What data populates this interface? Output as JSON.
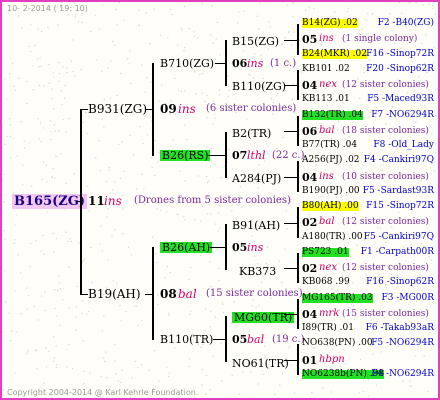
{
  "header_date": "10-  2-2014 ( 19: 10)",
  "footer": "Copyright 2004-2014 @ Karl Kehrle Foundation.",
  "root": {
    "label": "B165(ZG)",
    "gen": "11",
    "ins": "ins",
    "note": "(Drones from 5 sister colonies)"
  },
  "dam1": {
    "label": "B931(ZG)",
    "gen": "09",
    "ins": "ins",
    "note": "(6 sister colonies)"
  },
  "dam2": {
    "label": "B19(AH)",
    "gen": "08",
    "ins": "bal",
    "note": "(15 sister colonies)"
  },
  "g1": {
    "label": "B710(ZG)",
    "gen": "06",
    "ins": "ins",
    "note": "(1 c.)"
  },
  "g2": {
    "label": "B26(RS)",
    "gen": "07",
    "ins": "lthl",
    "note": "(22 c.)"
  },
  "g3": {
    "label": "B26(AH)",
    "gen": "05",
    "ins": "ins"
  },
  "g4": {
    "label": "B110(TR)",
    "gen": "05",
    "ins": "bal",
    "note": "(19 c.)"
  },
  "l3": {
    "a": "B15(ZG)",
    "b": "B110(ZG)",
    "c": "B2(TR)",
    "d": "A284(PJ)",
    "e": "B91(AH)",
    "f": "KB373",
    "g": "MG60(TR)",
    "h": "NO61(TR)"
  },
  "r": [
    {
      "n": "B14(ZG) .02",
      "s": "F2 -B40(ZG)"
    },
    {
      "g": "05",
      "i": "ins",
      "t": "(1 single colony)"
    },
    {
      "n": "B24(MKR) .02",
      "s": "F16 -Sinop72R"
    },
    {
      "n": "KB101 .02",
      "s": "F20 -Sinop62R"
    },
    {
      "g": "04",
      "i": "nex",
      "t": "(12 sister colonies)"
    },
    {
      "n": "KB113 .01",
      "s": "F5 -Maced93R"
    },
    {
      "n": "B132(TR) .04",
      "s": "F7 -NO6294R"
    },
    {
      "g": "06",
      "i": "bal",
      "t": "(18 sister colonies)"
    },
    {
      "n": "B77(TR) .04",
      "s": "F8 -Old_Lady"
    },
    {
      "n": "A256(PJ) .02",
      "s": "F4 -Cankiri97Q"
    },
    {
      "g": "04",
      "i": "ins",
      "t": "(10 sister colonies)"
    },
    {
      "n": "B190(PJ) .00",
      "s": "F5 -Sardast93R"
    },
    {
      "n": "B80(AH) .00",
      "s": "F15 -Sinop72R"
    },
    {
      "g": "02",
      "i": "bal",
      "t": "(12 sister colonies)"
    },
    {
      "n": "A180(TR) .00",
      "s": "F5 -Cankiri97Q"
    },
    {
      "n": "PS723 .01",
      "s": "F1 -Carpath00R"
    },
    {
      "g": "02",
      "i": "nex",
      "t": "(12 sister colonies)"
    },
    {
      "n": "KB068 .99",
      "s": "F16 -Sinop62R"
    },
    {
      "n": "MG165(TR) .03",
      "s": "F3 -MG00R"
    },
    {
      "g": "04",
      "i": "mrk",
      "t": "(15 sister colonies)"
    },
    {
      "n": "I89(TR) .01",
      "s": "F6 -Takab93aR"
    },
    {
      "n": "NO638(PN) .00",
      "s": "F5 -NO6294R"
    },
    {
      "g": "01",
      "i": "hbpn",
      "t": ""
    },
    {
      "n": "NO6238b(PN) .98",
      "s": "F4 -NO6294R"
    }
  ],
  "colors": {
    "yellow": "#ffff00",
    "green": "#22e022",
    "root_bg": "#f0c8f0",
    "border": "#e040c0"
  }
}
